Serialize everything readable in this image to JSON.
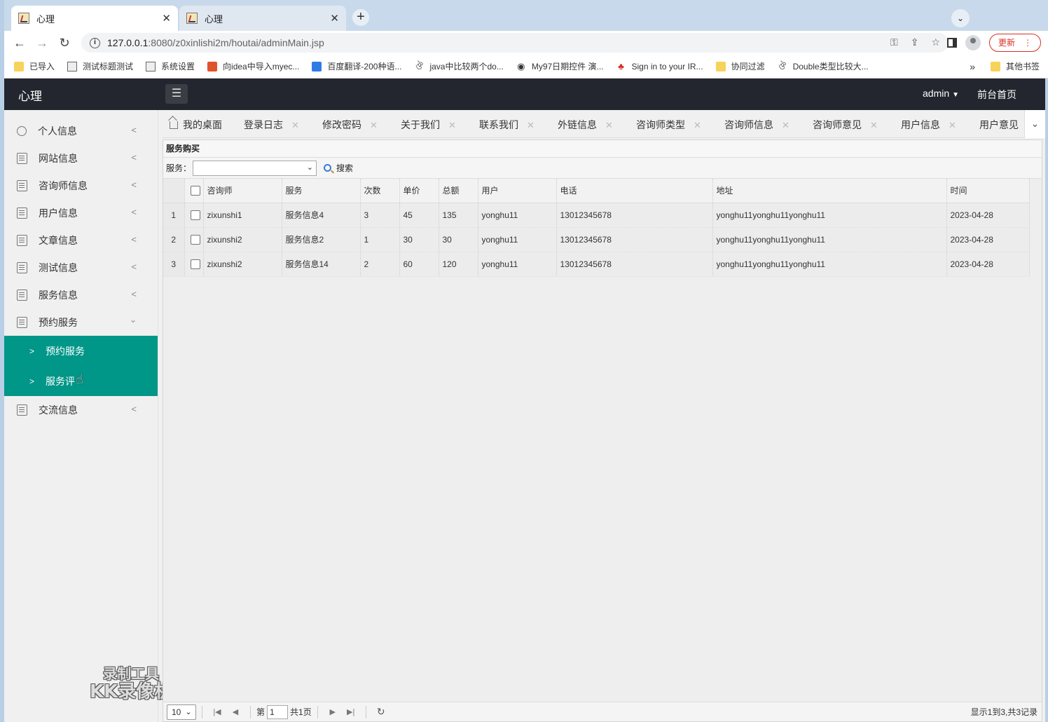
{
  "browser": {
    "tabs": [
      {
        "title": "心理",
        "close": "✕"
      },
      {
        "title": "心理",
        "close": "✕"
      }
    ],
    "url_host": "127.0.0.1",
    "url_rest": ":8080/z0xinlishi2m/houtai/adminMain.jsp",
    "update_label": "更新",
    "bookmarks": [
      {
        "label": "已导入",
        "icon": "folder"
      },
      {
        "label": "测试标题测试",
        "icon": "img"
      },
      {
        "label": "系统设置",
        "icon": "img"
      },
      {
        "label": "向idea中导入myec...",
        "icon": "red"
      },
      {
        "label": "百度翻译-200种语...",
        "icon": "blue"
      },
      {
        "label": "java中比较两个do...",
        "icon": "sym"
      },
      {
        "label": "My97日期控件 演...",
        "icon": "sym"
      },
      {
        "label": "Sign in to your IR...",
        "icon": "sym"
      },
      {
        "label": "协同过滤",
        "icon": "folder"
      },
      {
        "label": "Double类型比较大...",
        "icon": "sym"
      }
    ],
    "bookmarks_more": "»",
    "other_bookmarks": "其他书签"
  },
  "app": {
    "brand": "心理",
    "menu_toggle_icon": "list-icon",
    "admin": "admin",
    "front_link": "前台首页"
  },
  "sidebar": {
    "items": [
      {
        "label": "个人信息"
      },
      {
        "label": "网站信息"
      },
      {
        "label": "咨询师信息"
      },
      {
        "label": "用户信息"
      },
      {
        "label": "文章信息"
      },
      {
        "label": "测试信息"
      },
      {
        "label": "服务信息"
      },
      {
        "label": "预约服务"
      }
    ],
    "submenu": [
      {
        "label": "预约服务"
      },
      {
        "label": "服务评"
      }
    ],
    "last_item": {
      "label": "交流信息"
    }
  },
  "page_tabs": [
    {
      "label": "我的桌面"
    },
    {
      "label": "登录日志"
    },
    {
      "label": "修改密码"
    },
    {
      "label": "关于我们"
    },
    {
      "label": "联系我们"
    },
    {
      "label": "外链信息"
    },
    {
      "label": "咨询师类型"
    },
    {
      "label": "咨询师信息"
    },
    {
      "label": "咨询师意见"
    },
    {
      "label": "用户信息"
    },
    {
      "label": "用户意见"
    }
  ],
  "panel": {
    "title": "服务购买",
    "search_label": "服务：",
    "search_value": "",
    "search_button": "搜索",
    "columns": [
      "咨询师",
      "服务",
      "次数",
      "单价",
      "总额",
      "用户",
      "电话",
      "地址",
      "时间"
    ],
    "rows": [
      {
        "n": "1",
        "cells": [
          "zixunshi1",
          "服务信息4",
          "3",
          "45",
          "135",
          "yonghu11",
          "13012345678",
          "yonghu11yonghu11yonghu11",
          "2023-04-28"
        ]
      },
      {
        "n": "2",
        "cells": [
          "zixunshi2",
          "服务信息2",
          "1",
          "30",
          "30",
          "yonghu11",
          "13012345678",
          "yonghu11yonghu11yonghu11",
          "2023-04-28"
        ]
      },
      {
        "n": "3",
        "cells": [
          "zixunshi2",
          "服务信息14",
          "2",
          "60",
          "120",
          "yonghu11",
          "13012345678",
          "yonghu11yonghu11yonghu11",
          "2023-04-28"
        ]
      }
    ]
  },
  "pager": {
    "page_size": "10",
    "page_prefix": "第",
    "page_value": "1",
    "page_total": "共1页",
    "info": "显示1到3,共3记录"
  },
  "watermark": {
    "line1": "录制工具",
    "line2": "KK录像机"
  }
}
